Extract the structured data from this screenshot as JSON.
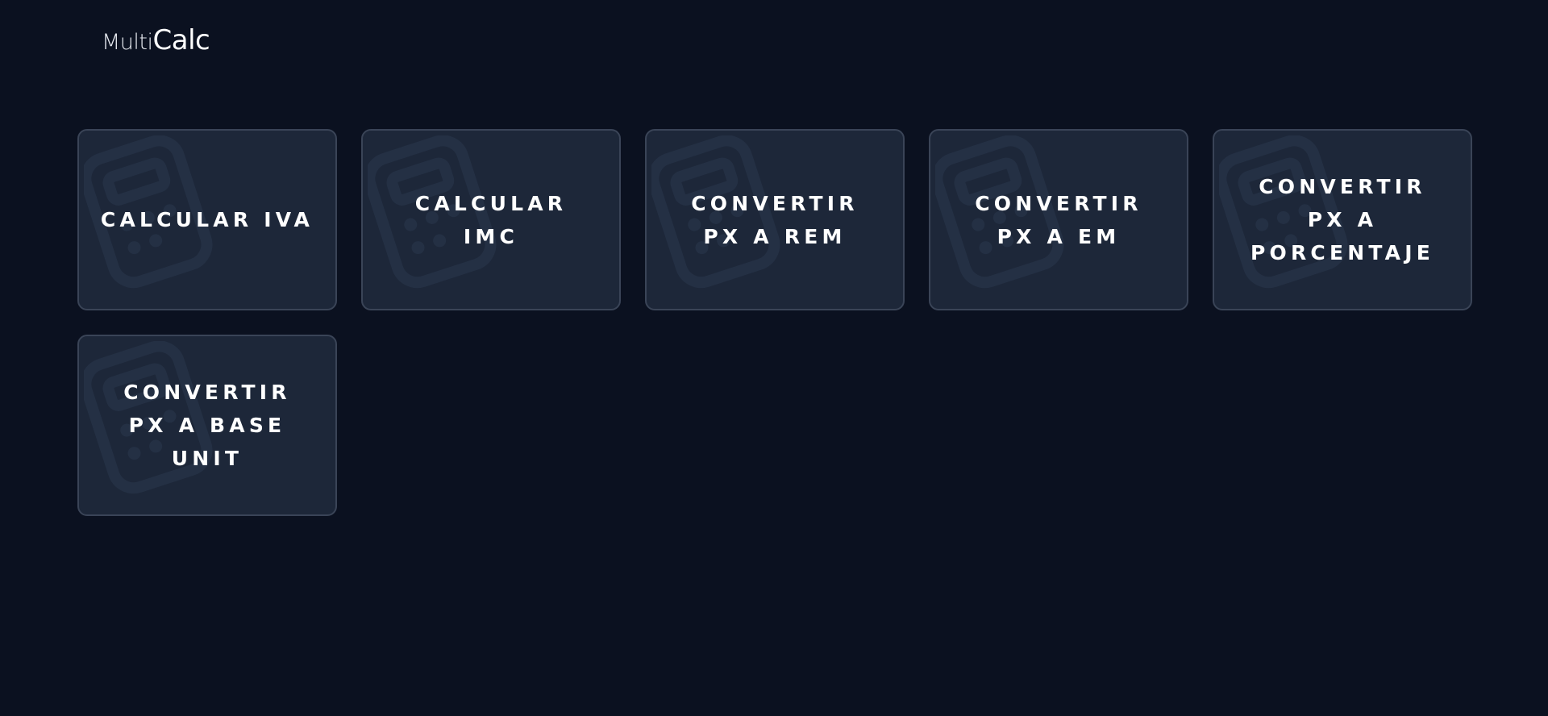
{
  "header": {
    "logo_part1": "Multi",
    "logo_part2": "Calc"
  },
  "cards": [
    {
      "label": "CALCULAR IVA"
    },
    {
      "label": "CALCULAR\nIMC"
    },
    {
      "label": "CONVERTIR\nPX A REM"
    },
    {
      "label": "CONVERTIR\nPX A EM"
    },
    {
      "label": "CONVERTIR\nPX A\nPORCENTAJE"
    },
    {
      "label": "CONVERTIR\nPX A BASE\nUNIT"
    }
  ],
  "icons": {
    "card_watermark": "calculator-icon"
  },
  "colors": {
    "background": "#0b1120",
    "card": "#1d2739",
    "card_border": "#3a4457",
    "text": "#ffffff"
  }
}
